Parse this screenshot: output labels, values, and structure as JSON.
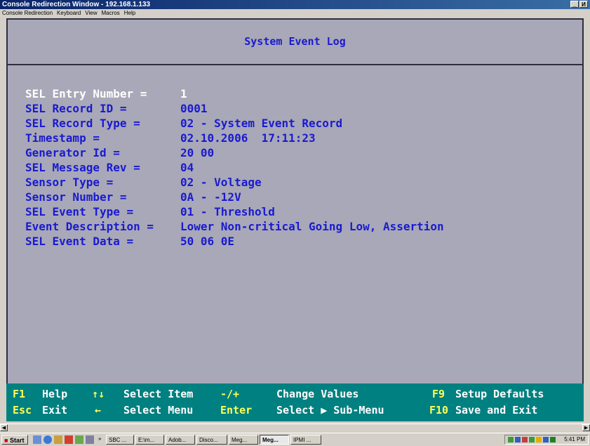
{
  "window": {
    "title": "Console Redirection Window - 192.168.1.133",
    "minimize": "_",
    "restore": "И"
  },
  "menu": [
    "Console Redirection",
    "Keyboard",
    "View",
    "Macros",
    "Help"
  ],
  "screen": {
    "title": "System Event Log",
    "fields": [
      {
        "label": "SEL Entry Number =",
        "value": "1",
        "highlight": true
      },
      {
        "label": "SEL Record ID =",
        "value": "0001"
      },
      {
        "label": "SEL Record Type =",
        "value": "02 - System Event Record"
      },
      {
        "label": "Timestamp =",
        "value": "02.10.2006  17:11:23"
      },
      {
        "label": "Generator Id =",
        "value": "20 00"
      },
      {
        "label": "SEL Message Rev =",
        "value": "04"
      },
      {
        "label": "Sensor Type =",
        "value": "02 - Voltage"
      },
      {
        "label": "Sensor Number =",
        "value": "0A - -12V"
      },
      {
        "label": "SEL Event Type =",
        "value": "01 - Threshold"
      },
      {
        "label": "Event Description =",
        "value": "Lower Non-critical Going Low, Assertion"
      },
      {
        "label": "SEL Event Data =",
        "value": "50 06 0E"
      }
    ]
  },
  "footer": {
    "row1": [
      {
        "key": "F1",
        "text": "Help"
      },
      {
        "key": "↑↓",
        "text": "Select Item"
      },
      {
        "key": "-/+",
        "text": "Change Values"
      },
      {
        "key": "F9",
        "text": "Setup Defaults"
      }
    ],
    "row2": [
      {
        "key": "Esc",
        "text": "Exit"
      },
      {
        "key": "←",
        "text": "Select Menu"
      },
      {
        "key": "Enter",
        "text": "Select ▶ Sub-Menu"
      },
      {
        "key": "F10",
        "text": "Save and Exit"
      }
    ]
  },
  "taskbar": {
    "start": "Start",
    "chevron": "»",
    "tasks": [
      "SBC ...",
      "E:\\m...",
      "Adob...",
      "Disco...",
      "Meg...",
      "Meg...",
      "IPMI ..."
    ],
    "active_task_index": 5,
    "clock": "5:41 PM"
  },
  "colors": {
    "console_bg": "#a8a8b8",
    "label_blue": "#1a1ad0",
    "footer_bg": "#008080",
    "footer_key": "#ffff55"
  }
}
